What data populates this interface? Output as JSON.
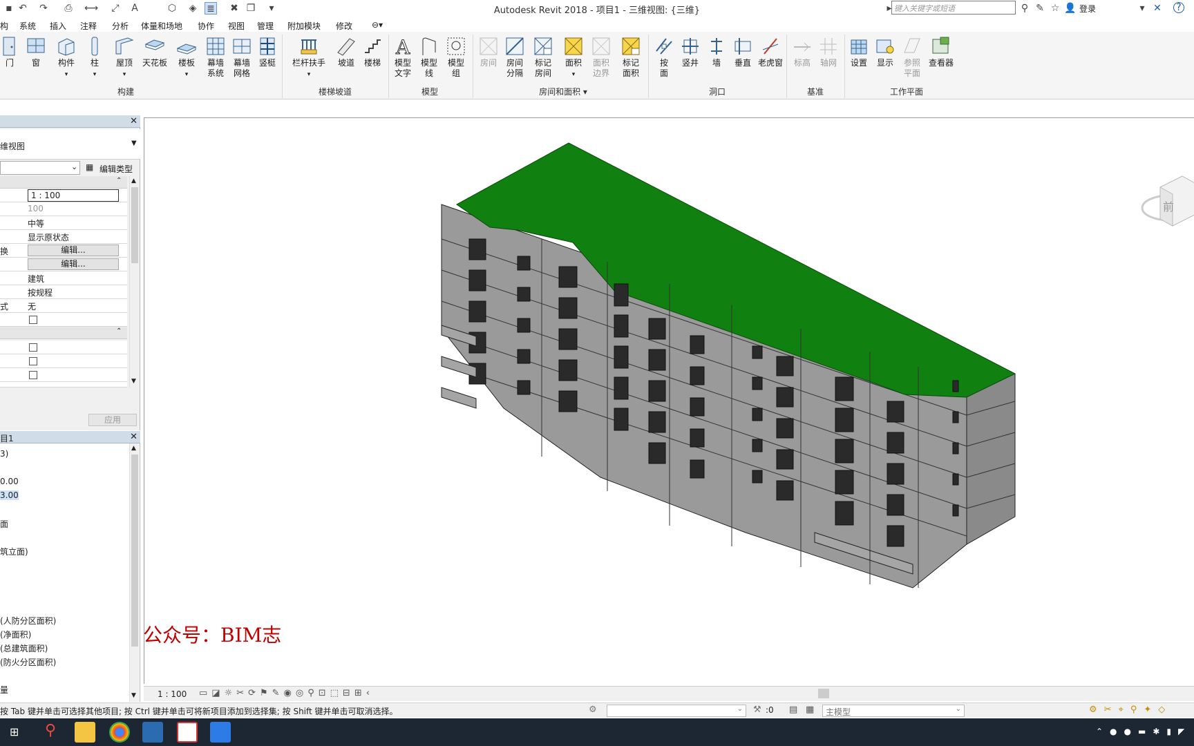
{
  "titlebar": {
    "app_title": "Autodesk Revit 2018 -    项目1 - 三维视图: {三维}",
    "search_placeholder": "键入关键字或短语",
    "login": "登录"
  },
  "menu": [
    "构",
    "系统",
    "插入",
    "注释",
    "分析",
    "体量和场地",
    "协作",
    "视图",
    "管理",
    "附加模块",
    "修改"
  ],
  "ribbon": {
    "panels": {
      "build": "构建",
      "stairs": "楼梯坡道",
      "model": "模型",
      "room": "房间和面积",
      "opening": "洞口",
      "datum": "基准",
      "workplane": "工作平面"
    },
    "buttons": {
      "door": "门",
      "window": "窗",
      "component": "构件",
      "column": "柱",
      "roof": "屋顶",
      "ceiling": "天花板",
      "floor": "楼板",
      "curtain_system": "幕墙\n系统",
      "curtain_grid": "幕墙\n网格",
      "mullion": "竖梃",
      "railing": "栏杆扶手",
      "ramp": "坡道",
      "stair": "楼梯",
      "model_text": "模型\n文字",
      "model_line": "模型\n线",
      "model_group": "模型\n组",
      "room": "房间",
      "room_sep": "房间\n分隔",
      "tag_room": "标记\n房间",
      "area": "面积",
      "area_boundary": "面积\n边界",
      "tag_area": "标记\n面积",
      "by_face": "按\n面",
      "shaft": "竖井",
      "wall": "墙",
      "vertical": "垂直",
      "dormer": "老虎窗",
      "level": "标高",
      "grid": "轴网",
      "set": "设置",
      "show": "显示",
      "ref_plane": "参照\n平面",
      "viewer": "查看器"
    }
  },
  "properties": {
    "type_label": "维视图",
    "edit_type": "编辑类型",
    "rows": [
      {
        "k": "",
        "v": "1 : 100"
      },
      {
        "k": "",
        "v": "100"
      },
      {
        "k": "",
        "v": "中等"
      },
      {
        "k": "",
        "v": "显示原状态"
      },
      {
        "k": "换",
        "v": "编辑..."
      },
      {
        "k": "",
        "v": "编辑..."
      },
      {
        "k": "",
        "v": "建筑"
      },
      {
        "k": "",
        "v": "按规程"
      },
      {
        "k": "式",
        "v": "无"
      }
    ],
    "apply": "应用"
  },
  "browser": {
    "title": "目1",
    "items": [
      "3)",
      "0.00",
      "3.00",
      "面",
      "筑立面)",
      "(人防分区面积)",
      "(净面积)",
      "(总建筑面积)",
      "(防火分区面积)",
      "量"
    ]
  },
  "viewport": {
    "watermark": "公众号：BIM志",
    "viewcube_label": "前"
  },
  "viewbar": {
    "scale": "1 : 100"
  },
  "statusbar": {
    "hint": "按 Tab 键并单击可选择其他项目; 按 Ctrl 键并单击可将新项目添加到选择集; 按 Shift 键并单击可取消选择。",
    "count": ":0",
    "model": "主模型"
  },
  "colors": {
    "roof": "#108010",
    "wall": "#999999",
    "accent": "#2b79c2",
    "watermark": "#c00000"
  }
}
